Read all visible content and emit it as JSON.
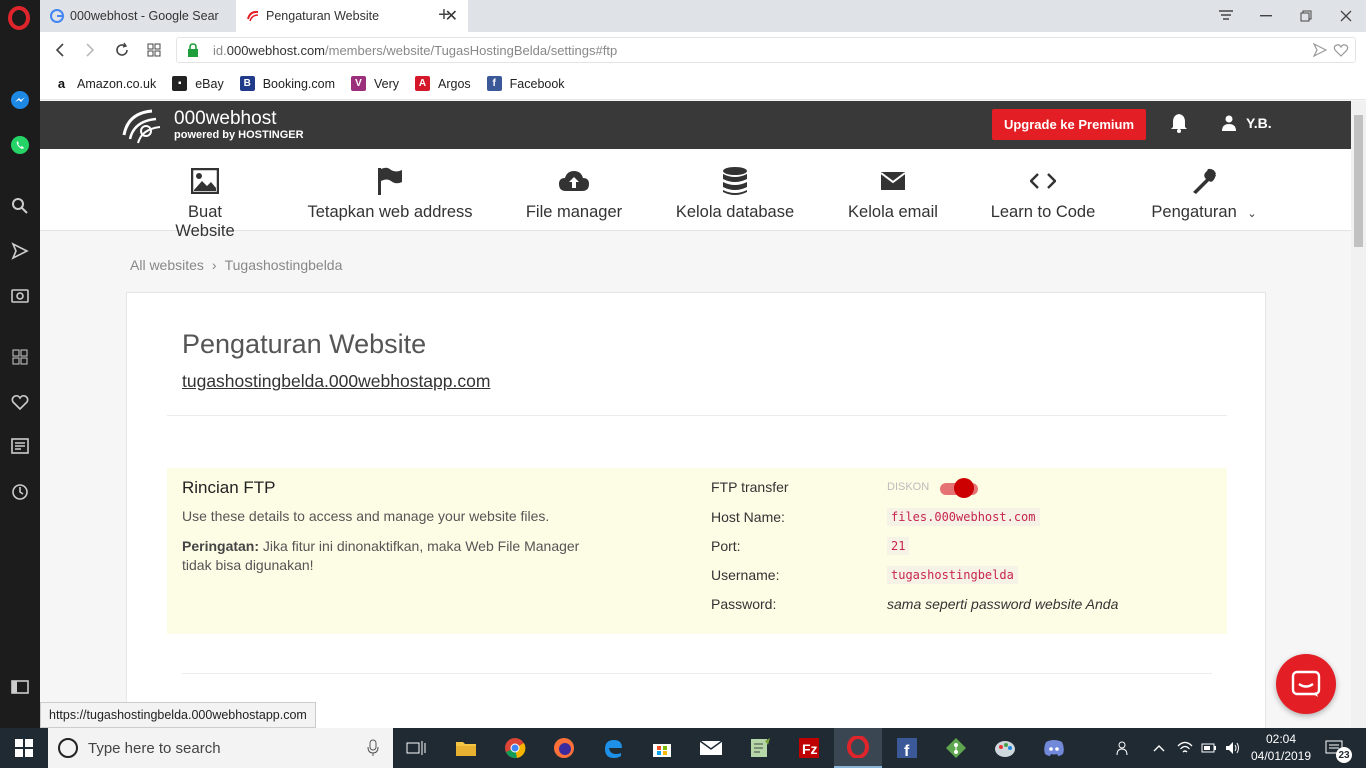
{
  "browser": {
    "tabs": [
      {
        "label": "000webhost - Google Sear",
        "active": false
      },
      {
        "label": "Pengaturan Website",
        "active": true
      }
    ],
    "url_scheme": "id.",
    "url_host": "000webhost.com",
    "url_path": "/members/website/TugasHostingBelda/settings#ftp",
    "bookmarks": [
      {
        "label": "Amazon.co.uk",
        "icon": "amazon-icon"
      },
      {
        "label": "eBay",
        "icon": "ebay-icon"
      },
      {
        "label": "Booking.com",
        "icon": "booking-icon"
      },
      {
        "label": "Very",
        "icon": "very-icon"
      },
      {
        "label": "Argos",
        "icon": "argos-icon"
      },
      {
        "label": "Facebook",
        "icon": "facebook-icon"
      }
    ],
    "status_url": "https://tugashostingbelda.000webhostapp.com"
  },
  "site": {
    "brand_name": "000webhost",
    "brand_sub": "powered by HOSTINGER",
    "upgrade_label": "Upgrade ke Premium",
    "user_initials": "Y.B.",
    "menu": [
      {
        "label": "Buat Website",
        "icon": "image-icon"
      },
      {
        "label": "Tetapkan web address",
        "icon": "flag-icon"
      },
      {
        "label": "File manager",
        "icon": "cloud-upload-icon"
      },
      {
        "label": "Kelola database",
        "icon": "database-icon"
      },
      {
        "label": "Kelola email",
        "icon": "envelope-icon"
      },
      {
        "label": "Learn to Code",
        "icon": "code-icon"
      },
      {
        "label": "Pengaturan",
        "icon": "wrench-icon"
      }
    ],
    "breadcrumb": [
      "All websites",
      "Tugashostingbelda"
    ],
    "breadcrumb_sep": "›",
    "page_title": "Pengaturan Website",
    "site_link": "tugashostingbelda.000webhostapp.com",
    "ftp": {
      "title": "Rincian FTP",
      "description": "Use these details to access and manage your website files.",
      "warning_label": "Peringatan:",
      "warning_text": " Jika fitur ini dinonaktifkan, maka Web File Manager tidak bisa digunakan!",
      "transfer_label": "FTP transfer",
      "transfer_off_label": "DISKON",
      "transfer_enabled": true,
      "host_label": "Host Name:",
      "host_value": "files.000webhost.com",
      "port_label": "Port:",
      "port_value": "21",
      "username_label": "Username:",
      "username_value": "tugashostingbelda",
      "password_label": "Password:",
      "password_value": "sama seperti password website Anda"
    }
  },
  "taskbar": {
    "search_placeholder": "Type here to search",
    "time": "02:04",
    "date": "04/01/2019",
    "notification_count": "23"
  },
  "colors": {
    "brand_red": "#e31e24",
    "header_bg": "#393939",
    "ftp_panel_bg": "#fdfde6",
    "code_color": "#c7254e"
  }
}
